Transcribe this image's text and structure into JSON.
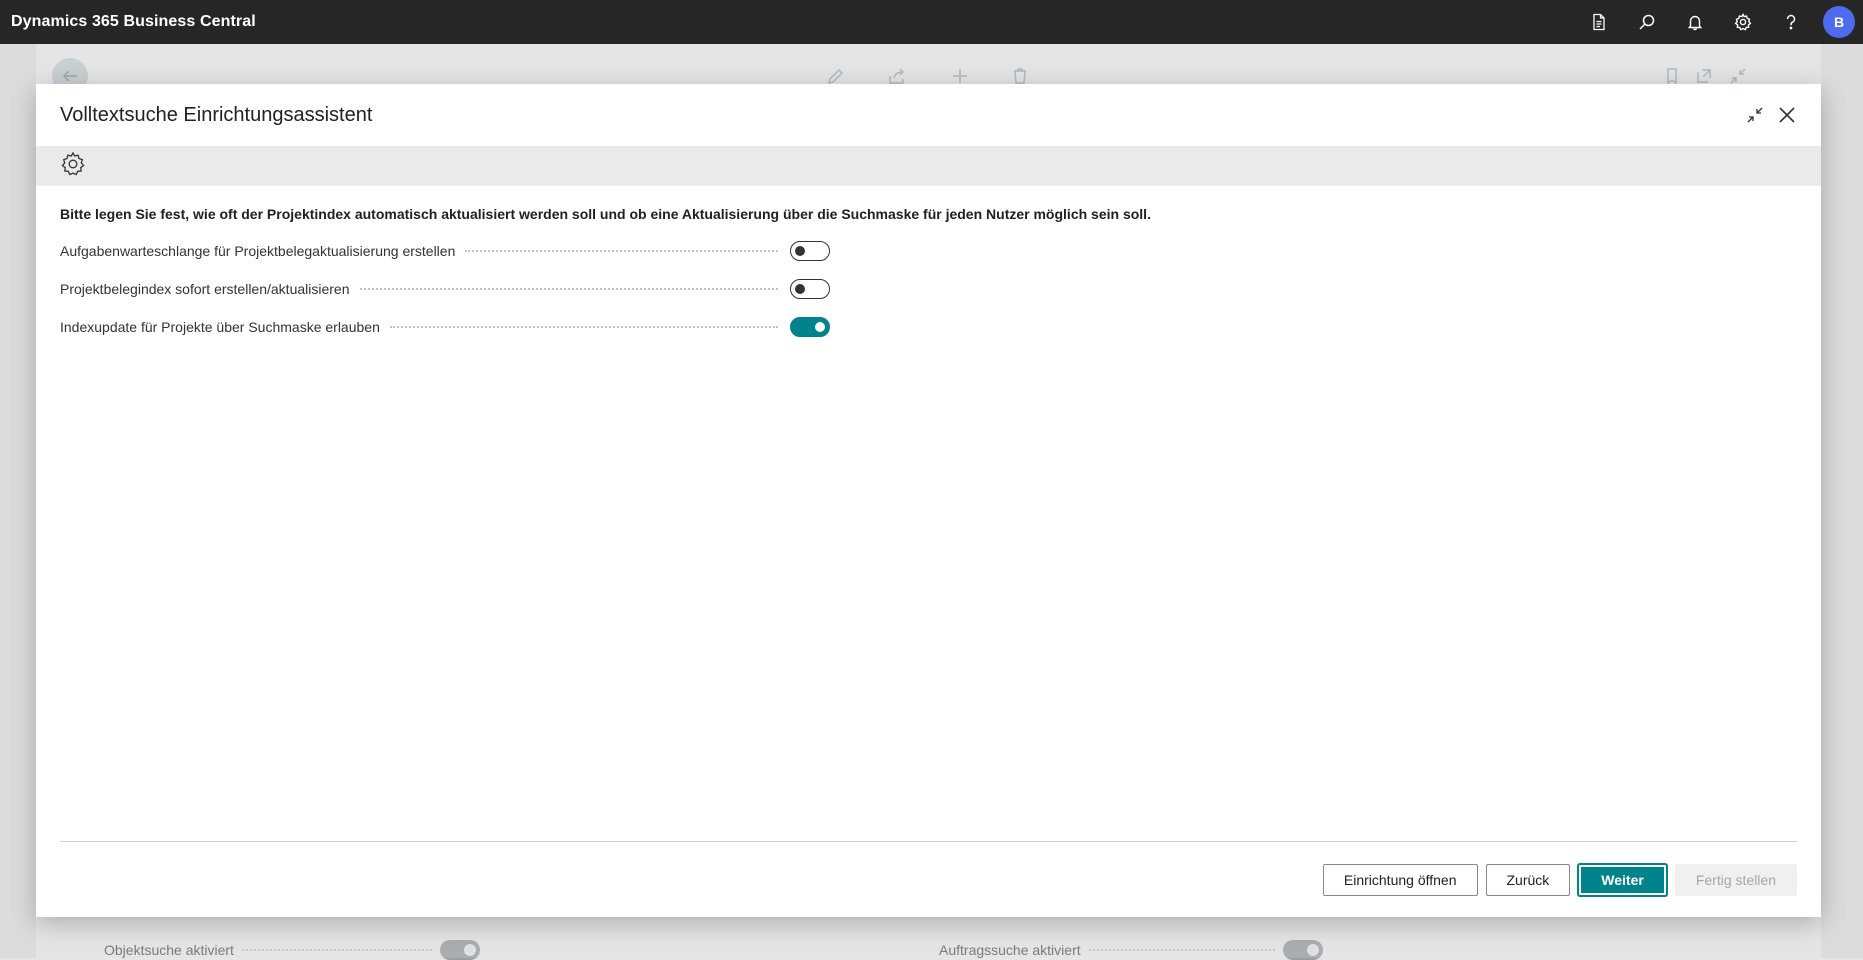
{
  "appbar": {
    "title": "Dynamics 365 Business Central",
    "icons": [
      "document-icon",
      "search-icon",
      "bell-icon",
      "gear-icon",
      "help-icon"
    ],
    "avatar_initial": "B",
    "avatar_color": "#4f6bed"
  },
  "background": {
    "fields": [
      {
        "label": "Objektsuche aktiviert",
        "toggle": "on"
      },
      {
        "label": "Auftragssuche aktiviert",
        "toggle": "on"
      }
    ]
  },
  "dialog": {
    "title": "Volltextsuche Einrichtungsassistent",
    "instruction": "Bitte legen Sie fest, wie oft der Projektindex automatisch aktualisiert werden soll und ob eine Aktualisierung über die Suchmaske für jeden Nutzer möglich sein soll.",
    "fields": [
      {
        "label": "Aufgabenwarteschlange für Projektbelegaktualisierung erstellen",
        "value": false
      },
      {
        "label": "Projektbelegindex sofort erstellen/aktualisieren",
        "value": false
      },
      {
        "label": "Indexupdate für Projekte über Suchmaske erlauben",
        "value": true
      }
    ],
    "buttons": {
      "open_setup": "Einrichtung öffnen",
      "back": "Zurück",
      "next": "Weiter",
      "finish": "Fertig stellen"
    }
  },
  "colors": {
    "accent": "#00838a",
    "appbar": "#262626"
  }
}
